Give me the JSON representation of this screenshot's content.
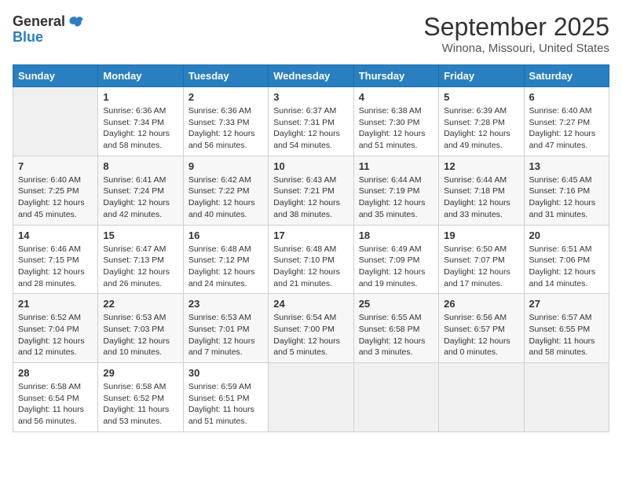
{
  "header": {
    "logo_general": "General",
    "logo_blue": "Blue",
    "title": "September 2025",
    "subtitle": "Winona, Missouri, United States"
  },
  "days_of_week": [
    "Sunday",
    "Monday",
    "Tuesday",
    "Wednesday",
    "Thursday",
    "Friday",
    "Saturday"
  ],
  "weeks": [
    [
      {
        "day": "",
        "content": ""
      },
      {
        "day": "1",
        "content": "Sunrise: 6:36 AM\nSunset: 7:34 PM\nDaylight: 12 hours and 58 minutes."
      },
      {
        "day": "2",
        "content": "Sunrise: 6:36 AM\nSunset: 7:33 PM\nDaylight: 12 hours and 56 minutes."
      },
      {
        "day": "3",
        "content": "Sunrise: 6:37 AM\nSunset: 7:31 PM\nDaylight: 12 hours and 54 minutes."
      },
      {
        "day": "4",
        "content": "Sunrise: 6:38 AM\nSunset: 7:30 PM\nDaylight: 12 hours and 51 minutes."
      },
      {
        "day": "5",
        "content": "Sunrise: 6:39 AM\nSunset: 7:28 PM\nDaylight: 12 hours and 49 minutes."
      },
      {
        "day": "6",
        "content": "Sunrise: 6:40 AM\nSunset: 7:27 PM\nDaylight: 12 hours and 47 minutes."
      }
    ],
    [
      {
        "day": "7",
        "content": "Sunrise: 6:40 AM\nSunset: 7:25 PM\nDaylight: 12 hours and 45 minutes."
      },
      {
        "day": "8",
        "content": "Sunrise: 6:41 AM\nSunset: 7:24 PM\nDaylight: 12 hours and 42 minutes."
      },
      {
        "day": "9",
        "content": "Sunrise: 6:42 AM\nSunset: 7:22 PM\nDaylight: 12 hours and 40 minutes."
      },
      {
        "day": "10",
        "content": "Sunrise: 6:43 AM\nSunset: 7:21 PM\nDaylight: 12 hours and 38 minutes."
      },
      {
        "day": "11",
        "content": "Sunrise: 6:44 AM\nSunset: 7:19 PM\nDaylight: 12 hours and 35 minutes."
      },
      {
        "day": "12",
        "content": "Sunrise: 6:44 AM\nSunset: 7:18 PM\nDaylight: 12 hours and 33 minutes."
      },
      {
        "day": "13",
        "content": "Sunrise: 6:45 AM\nSunset: 7:16 PM\nDaylight: 12 hours and 31 minutes."
      }
    ],
    [
      {
        "day": "14",
        "content": "Sunrise: 6:46 AM\nSunset: 7:15 PM\nDaylight: 12 hours and 28 minutes."
      },
      {
        "day": "15",
        "content": "Sunrise: 6:47 AM\nSunset: 7:13 PM\nDaylight: 12 hours and 26 minutes."
      },
      {
        "day": "16",
        "content": "Sunrise: 6:48 AM\nSunset: 7:12 PM\nDaylight: 12 hours and 24 minutes."
      },
      {
        "day": "17",
        "content": "Sunrise: 6:48 AM\nSunset: 7:10 PM\nDaylight: 12 hours and 21 minutes."
      },
      {
        "day": "18",
        "content": "Sunrise: 6:49 AM\nSunset: 7:09 PM\nDaylight: 12 hours and 19 minutes."
      },
      {
        "day": "19",
        "content": "Sunrise: 6:50 AM\nSunset: 7:07 PM\nDaylight: 12 hours and 17 minutes."
      },
      {
        "day": "20",
        "content": "Sunrise: 6:51 AM\nSunset: 7:06 PM\nDaylight: 12 hours and 14 minutes."
      }
    ],
    [
      {
        "day": "21",
        "content": "Sunrise: 6:52 AM\nSunset: 7:04 PM\nDaylight: 12 hours and 12 minutes."
      },
      {
        "day": "22",
        "content": "Sunrise: 6:53 AM\nSunset: 7:03 PM\nDaylight: 12 hours and 10 minutes."
      },
      {
        "day": "23",
        "content": "Sunrise: 6:53 AM\nSunset: 7:01 PM\nDaylight: 12 hours and 7 minutes."
      },
      {
        "day": "24",
        "content": "Sunrise: 6:54 AM\nSunset: 7:00 PM\nDaylight: 12 hours and 5 minutes."
      },
      {
        "day": "25",
        "content": "Sunrise: 6:55 AM\nSunset: 6:58 PM\nDaylight: 12 hours and 3 minutes."
      },
      {
        "day": "26",
        "content": "Sunrise: 6:56 AM\nSunset: 6:57 PM\nDaylight: 12 hours and 0 minutes."
      },
      {
        "day": "27",
        "content": "Sunrise: 6:57 AM\nSunset: 6:55 PM\nDaylight: 11 hours and 58 minutes."
      }
    ],
    [
      {
        "day": "28",
        "content": "Sunrise: 6:58 AM\nSunset: 6:54 PM\nDaylight: 11 hours and 56 minutes."
      },
      {
        "day": "29",
        "content": "Sunrise: 6:58 AM\nSunset: 6:52 PM\nDaylight: 11 hours and 53 minutes."
      },
      {
        "day": "30",
        "content": "Sunrise: 6:59 AM\nSunset: 6:51 PM\nDaylight: 11 hours and 51 minutes."
      },
      {
        "day": "",
        "content": ""
      },
      {
        "day": "",
        "content": ""
      },
      {
        "day": "",
        "content": ""
      },
      {
        "day": "",
        "content": ""
      }
    ]
  ]
}
